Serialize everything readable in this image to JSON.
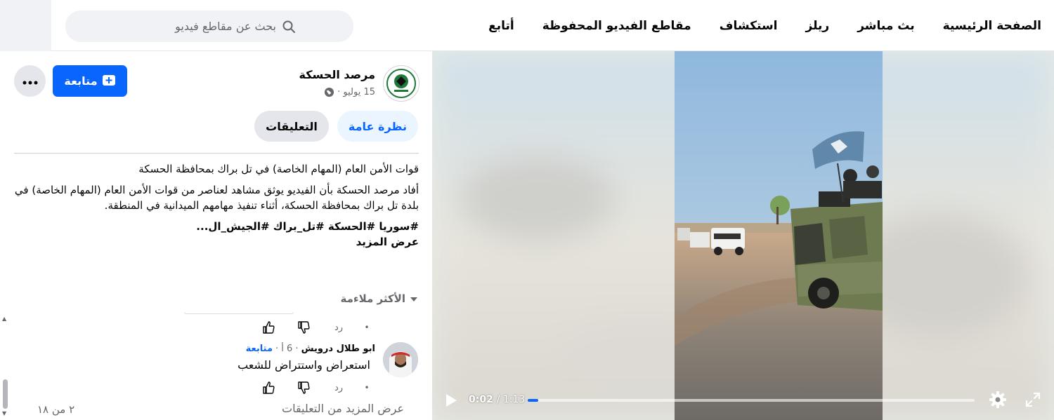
{
  "nav": {
    "items": [
      "الصفحة الرئيسية",
      "بث مباشر",
      "ريلز",
      "استكشاف",
      "مقاطع الفيديو المحفوظة",
      "أتابع"
    ],
    "search_placeholder": "بحث عن مقاطع فيديو"
  },
  "post": {
    "page_name": "مرصد الحسكة",
    "date": "15 يوليو ·",
    "follow_label": "متابعة",
    "tabs": {
      "overview": "نظرة عامة",
      "comments": "التعليقات"
    },
    "title": "قوات الأمن العام (المهام الخاصة) في تل براك بمحافظة الحسكة",
    "body": "أفاد مرصد الحسكة بأن الفيديو يوثق مشاهد لعناصر من قوات الأمن العام (المهام الخاصة) في بلدة تل براك بمحافظة الحسكة، أثناء تنفيذ مهامهم الميدانية في المنطقة.",
    "hashtags": "#سوريا #الحسكة #تل_براك #الجيش_ال...",
    "see_more": "عرض المزيد"
  },
  "comments": {
    "sort_label": "الأكثر ملاءمة",
    "reply_label": "رد",
    "items": [
      {
        "author": "ابو طلال درويش",
        "meta": "· 6 أ ·",
        "follow": "متابعة",
        "text": "استعراض واستتراض للشعب"
      }
    ],
    "more_label": "عرض المزيد من التعليقات",
    "count": "٢ من ١٨"
  },
  "video": {
    "current_time": "0:02",
    "total_time": "/ 1:13",
    "progress": 0.024
  },
  "colors": {
    "accent": "#0866ff",
    "follow_bg": "#0866ff",
    "tab_active_bg": "#ebf5ff"
  }
}
